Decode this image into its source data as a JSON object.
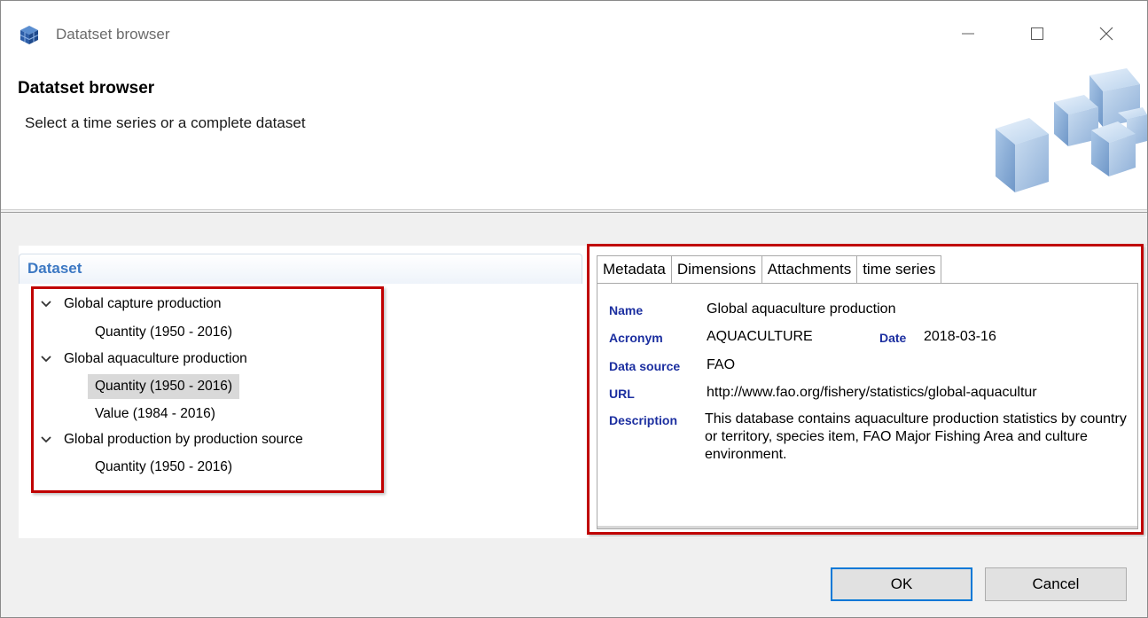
{
  "window": {
    "title": "Datatset browser"
  },
  "header": {
    "title": "Datatset browser",
    "subtitle": "Select a time series or a complete dataset"
  },
  "dataset": {
    "title": "Dataset",
    "tree": [
      {
        "label": "Global capture production",
        "children": [
          "Quantity (1950 - 2016)"
        ]
      },
      {
        "label": "Global aquaculture production",
        "children": [
          "Quantity (1950 - 2016)",
          "Value (1984 - 2016)"
        ]
      },
      {
        "label": "Global production by production source",
        "children": [
          "Quantity (1950 - 2016)"
        ]
      }
    ]
  },
  "tabs": [
    "Metadata",
    "Dimensions",
    "Attachments",
    "time series"
  ],
  "metadata": {
    "name_label": "Name",
    "name_value": "Global aquaculture production",
    "acronym_label": "Acronym",
    "acronym_value": "AQUACULTURE",
    "date_label": "Date",
    "date_value": "2018-03-16",
    "source_label": "Data source",
    "source_value": "FAO",
    "url_label": "URL",
    "url_value": "http://www.fao.org/fishery/statistics/global-aquacultur",
    "description_label": "Description",
    "description_value": "This database contains aquaculture production statistics by country or territory, species item, FAO Major Fishing Area and culture environment."
  },
  "buttons": {
    "ok": "OK",
    "cancel": "Cancel"
  }
}
